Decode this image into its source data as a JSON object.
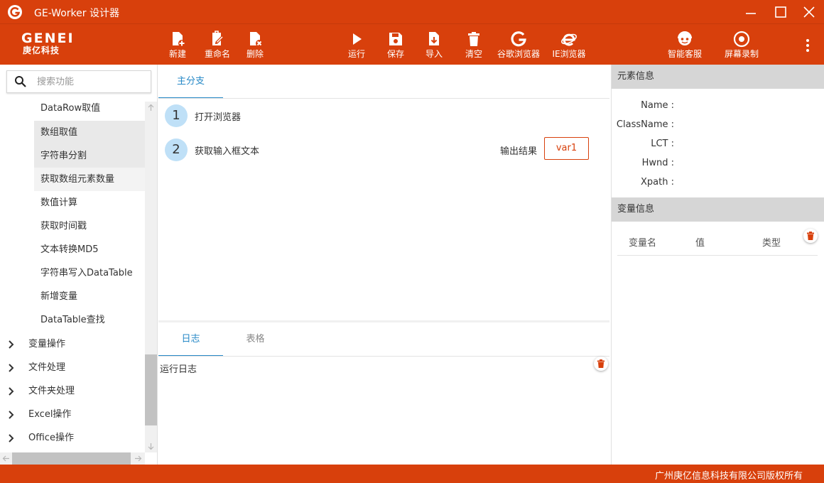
{
  "window": {
    "title": "GE-Worker 设计器",
    "controls": [
      "minimize",
      "maximize",
      "close"
    ]
  },
  "brand": {
    "logo_main": "GENEI",
    "logo_sub": "庚亿科技"
  },
  "toolbar": {
    "new": "新建",
    "rename": "重命名",
    "delete": "删除",
    "run": "运行",
    "save": "保存",
    "import": "导入",
    "clear": "清空",
    "chrome": "谷歌浏览器",
    "ie": "IE浏览器",
    "support": "智能客服",
    "record": "屏幕录制"
  },
  "sidebar": {
    "search_placeholder": "搜索功能",
    "items": [
      "DataRow取值",
      "数组取值",
      "字符串分割",
      "获取数组元素数量",
      "数值计算",
      "获取时间戳",
      "文本转换MD5",
      "字符串写入DataTable",
      "新增变量",
      "DataTable查找"
    ],
    "groups": [
      "变量操作",
      "文件处理",
      "文件夹处理",
      "Excel操作",
      "Office操作"
    ]
  },
  "flow": {
    "tab": "主分支",
    "steps": [
      {
        "num": "1",
        "label": "打开浏览器"
      },
      {
        "num": "2",
        "label": "获取输入框文本",
        "output_label": "输出结果",
        "output_var": "var1"
      }
    ]
  },
  "log": {
    "tabs": [
      "日志",
      "表格"
    ],
    "text": "运行日志"
  },
  "element_info": {
    "title": "元素信息",
    "fields": [
      "Name :",
      "ClassName :",
      "LCT :",
      "Hwnd :",
      "Xpath :"
    ]
  },
  "variable_info": {
    "title": "变量信息",
    "columns": [
      "变量名",
      "值",
      "类型"
    ]
  },
  "footer": {
    "copyright": "广州庚亿信息科技有限公司版权所有"
  },
  "colors": {
    "brand": "#d8400c",
    "accent": "#2789c7",
    "step_badge": "#bfe0f7"
  }
}
